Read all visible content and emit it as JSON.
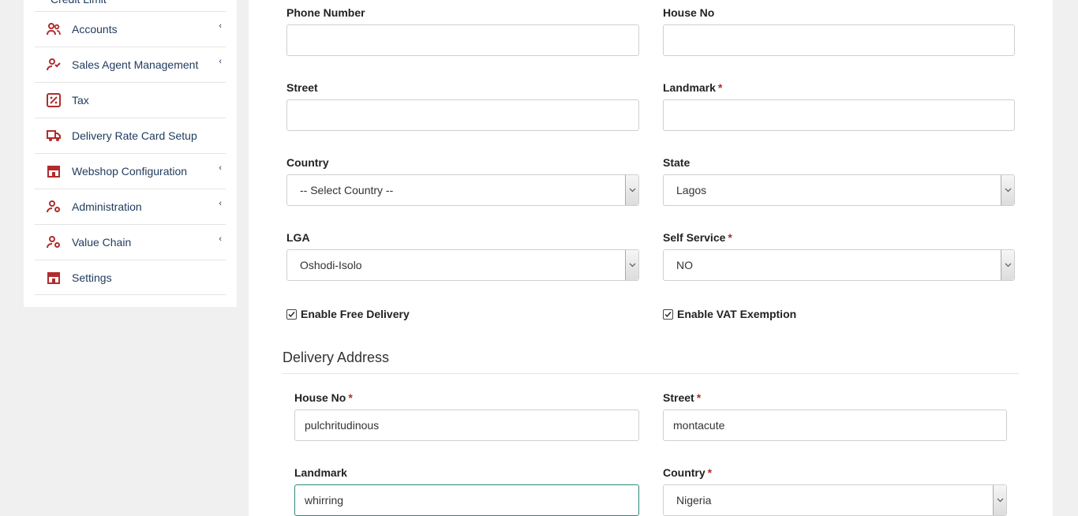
{
  "sidebar": {
    "partial_item": "Credit Limit",
    "items": [
      {
        "label": "Accounts",
        "icon": "users-icon",
        "has_submenu": true
      },
      {
        "label": "Sales Agent Management",
        "icon": "user-check-icon",
        "has_submenu": true
      },
      {
        "label": "Tax",
        "icon": "percent-icon",
        "has_submenu": false
      },
      {
        "label": "Delivery Rate Card Setup",
        "icon": "truck-icon",
        "has_submenu": false
      },
      {
        "label": "Webshop Configuration",
        "icon": "store-icon",
        "has_submenu": true
      },
      {
        "label": "Administration",
        "icon": "user-gear-icon",
        "has_submenu": true
      },
      {
        "label": "Value Chain",
        "icon": "user-gear-icon",
        "has_submenu": true
      },
      {
        "label": "Settings",
        "icon": "store-icon",
        "has_submenu": false
      }
    ],
    "caret": "‹"
  },
  "form": {
    "phone_number": {
      "label": "Phone Number",
      "value": ""
    },
    "house_no": {
      "label": "House No",
      "value": ""
    },
    "street": {
      "label": "Street",
      "value": ""
    },
    "landmark": {
      "label": "Landmark",
      "required": "*",
      "value": ""
    },
    "country": {
      "label": "Country",
      "value": "-- Select Country --"
    },
    "state": {
      "label": "State",
      "value": "Lagos"
    },
    "lga": {
      "label": "LGA",
      "value": "Oshodi-Isolo"
    },
    "self_service": {
      "label": "Self Service",
      "required": "*",
      "value": "NO"
    },
    "enable_free_delivery": {
      "label": "Enable Free Delivery",
      "checked": true
    },
    "enable_vat_exemption": {
      "label": "Enable VAT Exemption",
      "checked": true
    }
  },
  "delivery_address": {
    "title": "Delivery Address",
    "house_no": {
      "label": "House No",
      "required": "*",
      "value": "pulchritudinous"
    },
    "street": {
      "label": "Street",
      "required": "*",
      "value": "montacute"
    },
    "landmark": {
      "label": "Landmark",
      "value": "whirring"
    },
    "country": {
      "label": "Country",
      "required": "*",
      "value": "Nigeria"
    }
  },
  "colors": {
    "icon_accent": "#b22b2b",
    "sidebar_text": "#1f3a5c",
    "focus_border": "#2e8a7e"
  }
}
